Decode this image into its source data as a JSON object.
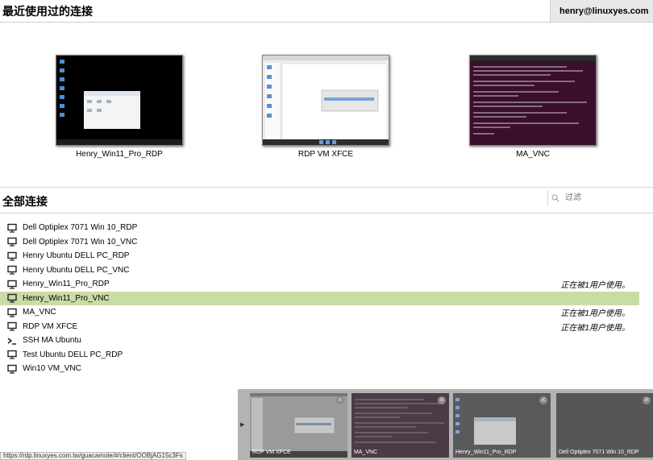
{
  "header": {
    "recent_title": "最近使用过的连接",
    "user": "henry@linuxyes.com"
  },
  "recent": [
    {
      "name": "Henry_Win11_Pro_RDP"
    },
    {
      "name": "RDP VM XFCE"
    },
    {
      "name": "MA_VNC"
    }
  ],
  "all": {
    "title": "全部连接",
    "filter_placeholder": "过滤",
    "items": [
      {
        "name": "Dell Optiplex 7071 Win 10_RDP",
        "icon": "monitor-icon",
        "status": ""
      },
      {
        "name": "Dell Optiplex 7071 Win 10_VNC",
        "icon": "monitor-icon",
        "status": ""
      },
      {
        "name": "Henry Ubuntu DELL PC_RDP",
        "icon": "monitor-icon",
        "status": ""
      },
      {
        "name": "Henry Ubuntu DELL PC_VNC",
        "icon": "monitor-icon",
        "status": ""
      },
      {
        "name": "Henry_Win11_Pro_RDP",
        "icon": "monitor-icon",
        "status": "正在被1用户使用。"
      },
      {
        "name": "Henry_Win11_Pro_VNC",
        "icon": "monitor-icon",
        "status": ""
      },
      {
        "name": "MA_VNC",
        "icon": "monitor-icon",
        "status": "正在被1用户使用。"
      },
      {
        "name": "RDP VM XFCE",
        "icon": "monitor-icon",
        "status": "正在被1用户使用。"
      },
      {
        "name": "SSH MA Ubuntu",
        "icon": "terminal-icon",
        "status": ""
      },
      {
        "name": "Test Ubuntu DELL PC_RDP",
        "icon": "monitor-icon",
        "status": ""
      },
      {
        "name": "Win10 VM_VNC",
        "icon": "monitor-icon",
        "status": ""
      }
    ]
  },
  "tray": [
    {
      "label": "RDP VM XFCE"
    },
    {
      "label": "MA_VNC"
    },
    {
      "label": "Henry_Win11_Pro_RDP"
    },
    {
      "label": "Dell Optiplex 7071 Win 10_RDP"
    }
  ],
  "status_url": "https://rdp.linuxyes.com.tw/guacamole/#/client/OOBjAG15c3Fs",
  "colors": {
    "selected_row": "#c9dca6",
    "tray_bg": "#b3b3b3"
  }
}
